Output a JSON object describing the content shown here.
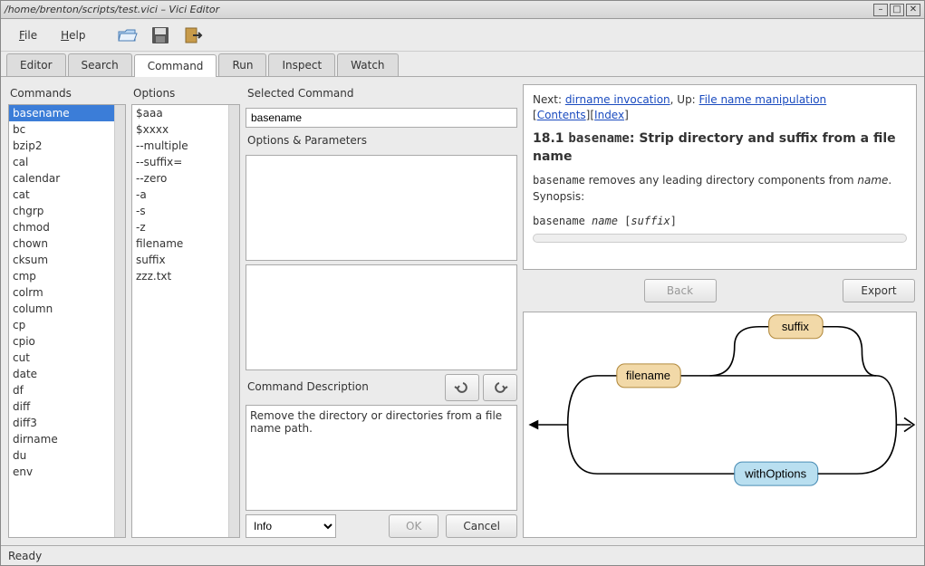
{
  "window": {
    "title": "/home/brenton/scripts/test.vici – Vici Editor"
  },
  "menu": {
    "file": "File",
    "help": "Help"
  },
  "tabs": [
    "Editor",
    "Search",
    "Command",
    "Run",
    "Inspect",
    "Watch"
  ],
  "active_tab": "Command",
  "labels": {
    "commands": "Commands",
    "options": "Options",
    "selected": "Selected Command",
    "opts_params": "Options & Parameters",
    "desc": "Command Description"
  },
  "commands": [
    "basename",
    "bc",
    "bzip2",
    "cal",
    "calendar",
    "cat",
    "chgrp",
    "chmod",
    "chown",
    "cksum",
    "cmp",
    "colrm",
    "column",
    "cp",
    "cpio",
    "cut",
    "date",
    "df",
    "diff",
    "diff3",
    "dirname",
    "du",
    "env"
  ],
  "selected_command": "basename",
  "options": [
    "$aaa",
    "$xxxx",
    "--multiple",
    "--suffix=",
    "--zero",
    "-a",
    "-s",
    "-z",
    "filename",
    "suffix",
    "zzz.txt"
  ],
  "selected_input": "basename",
  "description": "Remove the directory or directories from a file name path.",
  "info_select": "Info",
  "buttons": {
    "ok": "OK",
    "cancel": "Cancel",
    "back": "Back",
    "export": "Export"
  },
  "help": {
    "next": "Next: ",
    "next_link": "dirname invocation",
    "up": ", Up: ",
    "up_link": "File name manipulation",
    "contents": "Contents",
    "index": "Index",
    "heading_num": "18.1 ",
    "heading_cmd": "basename",
    "heading_rest": ": Strip directory and suffix from a file name",
    "para1a": "basename",
    "para1b": " removes any leading directory components from ",
    "para1c": "name",
    "para1d": ". Synopsis:",
    "syn_a": "basename ",
    "syn_b": "name",
    "syn_c": " [",
    "syn_d": "suffix",
    "syn_e": "]"
  },
  "diagram": {
    "node1": "filename",
    "node2": "suffix",
    "node3": "withOptions"
  },
  "status": "Ready"
}
